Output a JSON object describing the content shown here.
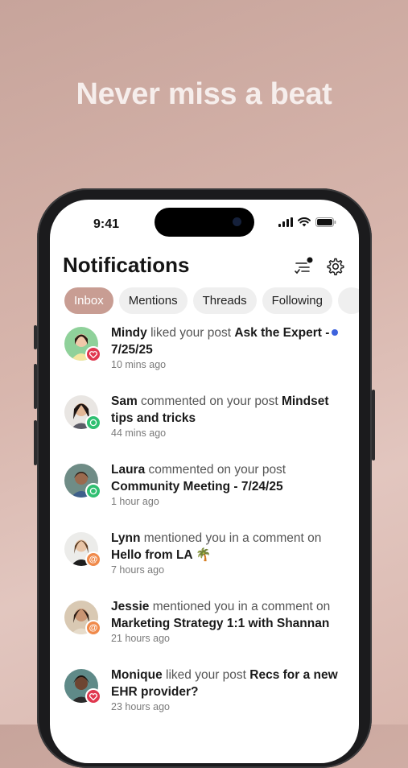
{
  "headline": "Never miss a beat",
  "status": {
    "time": "9:41"
  },
  "header": {
    "title": "Notifications",
    "filter_icon": "filter-check-icon",
    "settings_icon": "gear-icon"
  },
  "tabs": [
    {
      "label": "Inbox",
      "active": true
    },
    {
      "label": "Mentions",
      "active": false
    },
    {
      "label": "Threads",
      "active": false
    },
    {
      "label": "Following",
      "active": false
    }
  ],
  "colors": {
    "accent": "#c89d93",
    "unread_dot": "#3e63dd",
    "like_badge": "#e0384f",
    "comment_badge": "#2fbf71",
    "mention_badge": "#f08a4b"
  },
  "notifications": [
    {
      "name": "Mindy",
      "action": " liked your post ",
      "target": "Ask the Expert - 7/25/25",
      "time": "10 mins ago",
      "badge": "heart-icon",
      "unread": true
    },
    {
      "name": "Sam",
      "action": " commented on your post ",
      "target": "Mindset tips and tricks",
      "time": "44 mins ago",
      "badge": "comment-icon",
      "unread": false
    },
    {
      "name": "Laura",
      "action": " commented on your post ",
      "target": "Community Meeting - 7/24/25",
      "time": "1 hour ago",
      "badge": "comment-icon",
      "unread": false
    },
    {
      "name": "Lynn",
      "action": " mentioned you in a comment on ",
      "target": "Hello from LA 🌴",
      "time": "7 hours ago",
      "badge": "at-icon",
      "unread": false
    },
    {
      "name": "Jessie",
      "action": " mentioned you in a comment on ",
      "target": "Marketing Strategy 1:1 with Shannan",
      "time": "21 hours ago",
      "badge": "at-icon",
      "unread": false
    },
    {
      "name": "Monique",
      "action": " liked your post ",
      "target": "Recs for a new EHR provider?",
      "time": "23 hours ago",
      "badge": "heart-icon",
      "unread": false
    }
  ]
}
